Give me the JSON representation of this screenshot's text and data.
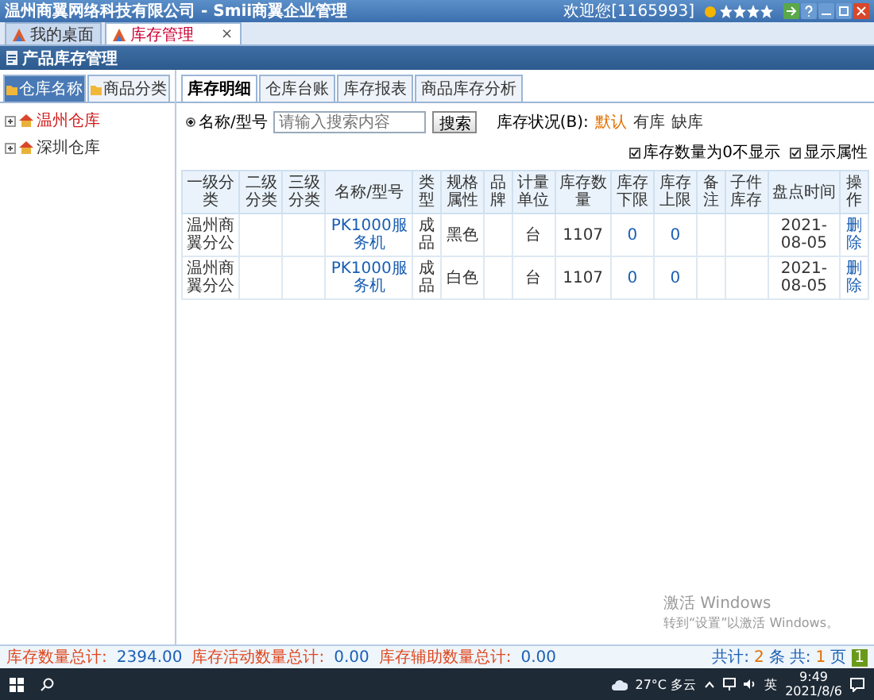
{
  "window": {
    "title": "温州商翼网络科技有限公司 - Smii商翼企业管理",
    "user": "欢迎您[1165993]"
  },
  "app_tabs": [
    {
      "label": "我的桌面",
      "selected": false
    },
    {
      "label": "库存管理",
      "selected": true,
      "close": "×"
    }
  ],
  "page_header": "产品库存管理",
  "sidebar": {
    "tabs": [
      {
        "label": "仓库名称",
        "selected": true
      },
      {
        "label": "商品分类",
        "selected": false
      }
    ],
    "tree": [
      {
        "label": "温州仓库",
        "selected": true
      },
      {
        "label": "深圳仓库",
        "selected": false
      }
    ]
  },
  "content_tabs": [
    {
      "label": "库存明细",
      "selected": true
    },
    {
      "label": "仓库台账",
      "selected": false
    },
    {
      "label": "库存报表",
      "selected": false
    },
    {
      "label": "商品库存分析",
      "selected": false
    }
  ],
  "search": {
    "mode": {
      "label": "名称/型号",
      "selected": true
    },
    "placeholder": "请输入搜索内容",
    "button": "搜索",
    "filter_label": "库存状况(B):",
    "filters": [
      {
        "label": "默认",
        "selected": true
      },
      {
        "label": "有库",
        "selected": false
      },
      {
        "label": "缺库",
        "selected": false
      }
    ]
  },
  "options": [
    {
      "label": "库存数量为0不显示",
      "checked": true
    },
    {
      "label": "显示属性",
      "checked": true
    }
  ],
  "table": {
    "columns": [
      {
        "label": "一级分类",
        "kind": "text"
      },
      {
        "label": "二级分类",
        "kind": "text"
      },
      {
        "label": "三级分类",
        "kind": "text"
      },
      {
        "label": "名称/型号",
        "kind": "link"
      },
      {
        "label": "类型",
        "kind": "text"
      },
      {
        "label": "规格属性",
        "kind": "text"
      },
      {
        "label": "品牌",
        "kind": "text"
      },
      {
        "label": "计量单位",
        "kind": "text"
      },
      {
        "label": "库存数量",
        "kind": "text"
      },
      {
        "label": "库存下限",
        "kind": "number"
      },
      {
        "label": "库存上限",
        "kind": "number"
      },
      {
        "label": "备注",
        "kind": "text"
      },
      {
        "label": "子件库存",
        "kind": "text"
      },
      {
        "label": "盘点时间",
        "kind": "text"
      },
      {
        "label": "操作",
        "kind": "link"
      }
    ],
    "rows": [
      [
        "温州商翼分公",
        null,
        null,
        "PK1000服务机",
        "成品",
        "黑色",
        null,
        "台",
        "1107",
        "0",
        "0",
        null,
        null,
        "2021-08-05",
        "删除"
      ],
      [
        "温州商翼分公",
        null,
        null,
        "PK1000服务机",
        "成品",
        "白色",
        null,
        "台",
        "1107",
        "0",
        "0",
        null,
        null,
        "2021-08-05",
        "删除"
      ]
    ]
  },
  "footer": {
    "totals": [
      {
        "label": "库存数量总计:",
        "value": "2394.00"
      },
      {
        "label": "库存活动数量总计:",
        "value": "0.00"
      },
      {
        "label": "库存辅助数量总计:",
        "value": "0.00"
      }
    ],
    "pager": {
      "total_label": "共计:",
      "total": "2",
      "total_unit": "条",
      "pages_label": "共:",
      "pages": "1",
      "pages_unit": "页",
      "page": "1"
    }
  },
  "activation": {
    "title": "激活 Windows",
    "hint": "转到“设置”以激活 Windows。"
  },
  "taskbar": {
    "weather": "27°C 多云",
    "lang": "英",
    "time": "9:49",
    "date": "2021/8/6"
  }
}
